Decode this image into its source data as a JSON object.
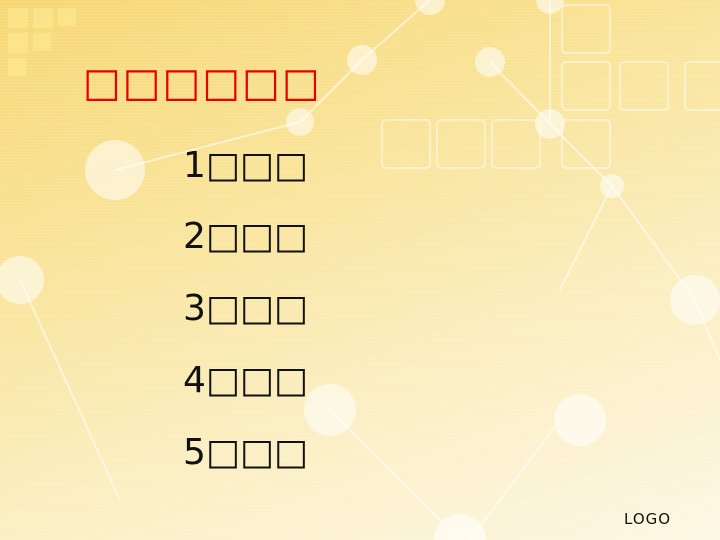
{
  "slide": {
    "title": "□□□□□□",
    "items": [
      "1□□□",
      "2□□□",
      "3□□□",
      "4□□□",
      "5□□□"
    ],
    "logo": "LOGO"
  },
  "colors": {
    "title": "#e60000",
    "text": "#111111",
    "background_start": "#f7d774",
    "background_end": "#fdf7e4"
  }
}
